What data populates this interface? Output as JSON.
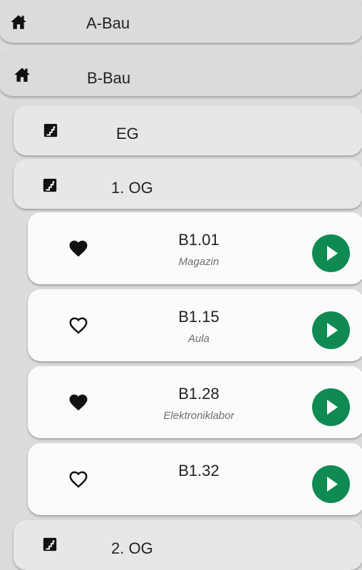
{
  "buildings": [
    {
      "label": "A-Bau",
      "icon": "home-icon"
    },
    {
      "label": "B-Bau",
      "icon": "home-icon"
    }
  ],
  "floors": [
    {
      "label": "EG",
      "icon": "stairs-icon"
    },
    {
      "label": "1. OG",
      "icon": "stairs-icon"
    },
    {
      "label": "2. OG",
      "icon": "stairs-icon"
    }
  ],
  "rooms": [
    {
      "number": "B1.01",
      "name": "Magazin",
      "favorite": true
    },
    {
      "number": "B1.15",
      "name": "Aula",
      "favorite": false
    },
    {
      "number": "B1.28",
      "name": "Elektroniklabor",
      "favorite": true
    },
    {
      "number": "B1.32",
      "name": "",
      "favorite": false
    }
  ],
  "colors": {
    "play_button": "#0f8a53",
    "building_bg": "#dbdbdb",
    "floor_bg": "#e7e7e7",
    "room_bg": "#fbfbfb"
  }
}
